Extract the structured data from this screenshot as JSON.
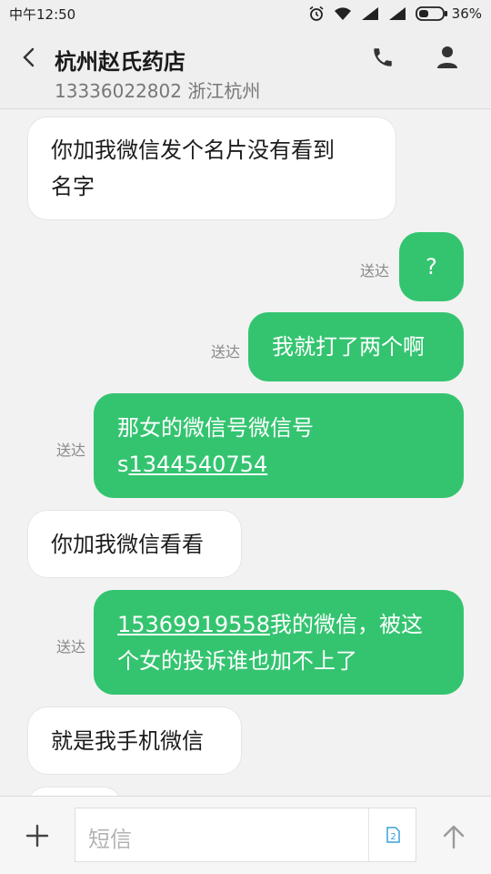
{
  "status_bar": {
    "time": "中午12:50",
    "battery_percent": "36%"
  },
  "header": {
    "contact_name": "杭州赵氏药店",
    "contact_number": "13336022802",
    "contact_location": "浙江杭州"
  },
  "messages": [
    {
      "direction": "incoming",
      "lines": [
        "你加我微信发个名片没有看到",
        "名字"
      ]
    },
    {
      "direction": "outgoing",
      "status": "送达",
      "text": "?"
    },
    {
      "direction": "outgoing",
      "status": "送达",
      "text": "我就打了两个啊"
    },
    {
      "direction": "outgoing",
      "status": "送达",
      "line1": "那女的微信号微信号",
      "line2_prefix": "s",
      "line2_link": "1344540754"
    },
    {
      "direction": "incoming",
      "text": "你加我微信看看"
    },
    {
      "direction": "outgoing",
      "status": "送达",
      "line1_link": "15369919558",
      "line1_rest": "我的微信，被这",
      "line2": "个女的投诉谁也加不上了"
    },
    {
      "direction": "incoming",
      "text": "就是我手机微信"
    }
  ],
  "input": {
    "placeholder": "短信",
    "sim_slot": "2"
  },
  "icons": {
    "back": "chevron-left-icon",
    "call": "phone-icon",
    "contact": "person-icon",
    "add": "plus-icon",
    "send": "arrow-up-icon"
  },
  "colors": {
    "outgoing_bubble": "#34c470",
    "incoming_bubble": "#ffffff",
    "sim_badge": "#3aa0d8"
  }
}
